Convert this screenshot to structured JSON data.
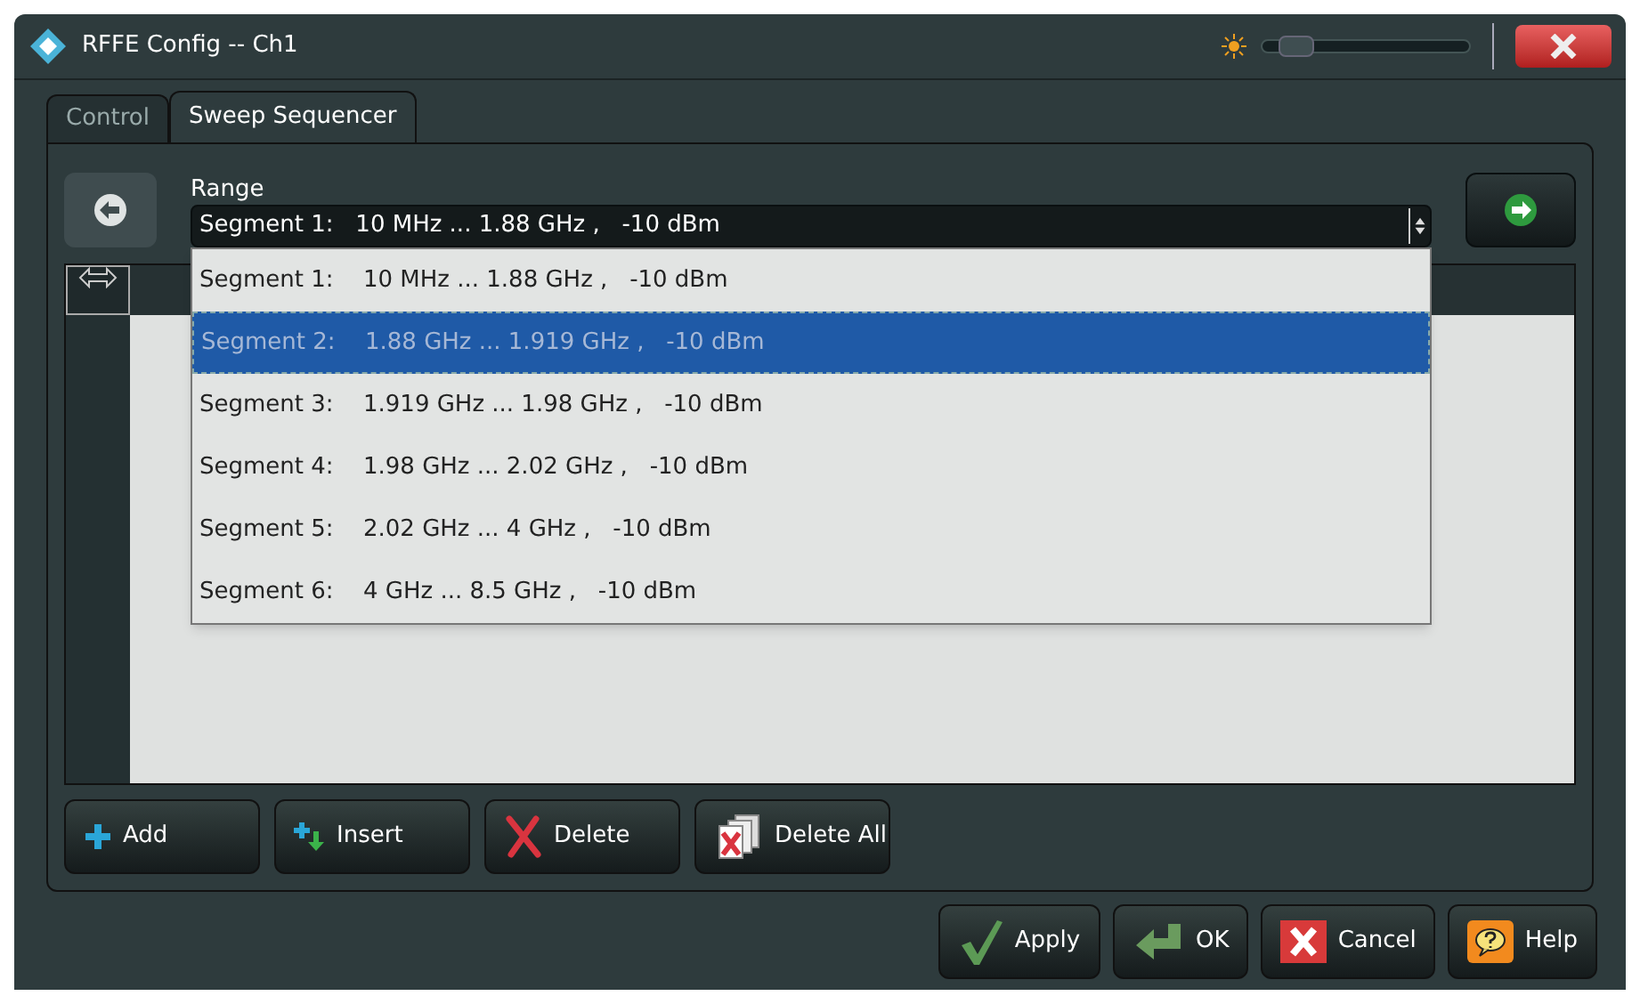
{
  "window": {
    "title": "RFFE Config -- Ch1"
  },
  "brightness": {
    "level": 0.08
  },
  "tabs": [
    {
      "label": "Control",
      "selected": false
    },
    {
      "label": "Sweep Sequencer",
      "selected": true
    }
  ],
  "range": {
    "label": "Range",
    "value": "Segment 1:   10 MHz ... 1.88 GHz ,   -10 dBm",
    "expanded": true,
    "options": [
      {
        "label": "Segment 1:",
        "range": "10 MHz ... 1.88 GHz ,   -10 dBm",
        "selected": false
      },
      {
        "label": "Segment 2:",
        "range": "1.88 GHz ... 1.919 GHz ,   -10 dBm",
        "selected": true
      },
      {
        "label": "Segment 3:",
        "range": "1.919 GHz ... 1.98 GHz ,   -10 dBm",
        "selected": false
      },
      {
        "label": "Segment 4:",
        "range": "1.98 GHz ... 2.02 GHz ,   -10 dBm",
        "selected": false
      },
      {
        "label": "Segment 5:",
        "range": "2.02 GHz ... 4 GHz ,   -10 dBm",
        "selected": false
      },
      {
        "label": "Segment 6:",
        "range": "4 GHz ... 8.5 GHz ,   -10 dBm",
        "selected": false
      }
    ]
  },
  "table_buttons": [
    {
      "kind": "add",
      "label": "Add"
    },
    {
      "kind": "insert",
      "label": "Insert"
    },
    {
      "kind": "delete",
      "label": "Delete"
    },
    {
      "kind": "delete_all",
      "label": "Delete All"
    }
  ],
  "dialog_buttons": [
    {
      "kind": "apply",
      "label": "Apply"
    },
    {
      "kind": "ok",
      "label": "OK"
    },
    {
      "kind": "cancel",
      "label": "Cancel"
    },
    {
      "kind": "help",
      "label": "Help"
    }
  ]
}
